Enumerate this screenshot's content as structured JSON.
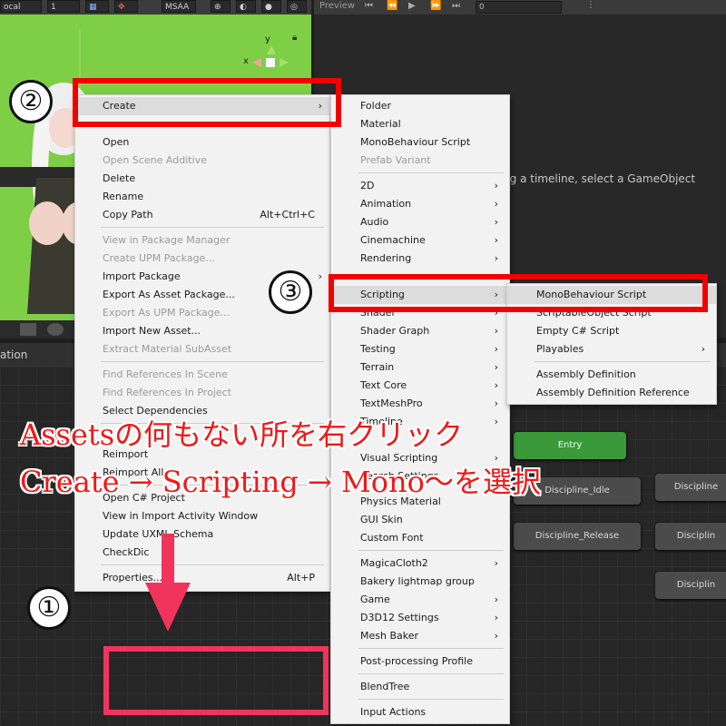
{
  "scene_toolbar": {
    "pivot_label": "ocal",
    "layer_value": "1",
    "msaa_label": "MSAA"
  },
  "preview_toolbar": {
    "label": "Preview",
    "frame_value": "0"
  },
  "timeline": {
    "message": "ting a timeline, select a GameObject"
  },
  "animator": {
    "tab_label": "ation"
  },
  "gizmo": {
    "x_label": "x",
    "y_label": "y"
  },
  "context_menu": {
    "items": [
      {
        "label": "Create",
        "arrow": "›",
        "highlight": true
      },
      {
        "label": "Open"
      },
      {
        "label": "Open Scene Additive",
        "disabled": true
      },
      {
        "label": "Delete"
      },
      {
        "label": "Rename"
      },
      {
        "label": "Copy Path",
        "shortcut": "Alt+Ctrl+C"
      },
      {
        "label": "View in Package Manager",
        "disabled": true
      },
      {
        "label": "Create UPM Package...",
        "disabled": true
      },
      {
        "label": "Import Package",
        "arrow": "›"
      },
      {
        "label": "Export As Asset Package..."
      },
      {
        "label": "Export As UPM Package...",
        "disabled": true
      },
      {
        "label": "Import New Asset..."
      },
      {
        "label": "Extract Material SubAsset",
        "disabled": true
      },
      {
        "label": "Find References In Scene",
        "disabled": true
      },
      {
        "label": "Find References In Project",
        "disabled": true
      },
      {
        "label": "Select Dependencies"
      },
      {
        "label": "Reimport"
      },
      {
        "label": "Reimport All"
      },
      {
        "label": "Open C# Project"
      },
      {
        "label": "View in Import Activity Window"
      },
      {
        "label": "Update UXML Schema"
      },
      {
        "label": "CheckDic"
      },
      {
        "label": "Properties...",
        "shortcut": "Alt+P"
      }
    ]
  },
  "create_submenu": {
    "items": [
      {
        "label": "Folder"
      },
      {
        "label": "Material"
      },
      {
        "label": "MonoBehaviour Script"
      },
      {
        "label": "Prefab Variant",
        "disabled": true
      },
      {
        "label": "2D",
        "arrow": "›"
      },
      {
        "label": "Animation",
        "arrow": "›"
      },
      {
        "label": "Audio",
        "arrow": "›"
      },
      {
        "label": "Cinemachine",
        "arrow": "›"
      },
      {
        "label": "Rendering",
        "arrow": "›"
      },
      {
        "label": "Scripting",
        "arrow": "›",
        "highlight": true
      },
      {
        "label": "Shader",
        "arrow": "›"
      },
      {
        "label": "Shader Graph",
        "arrow": "›"
      },
      {
        "label": "Testing",
        "arrow": "›"
      },
      {
        "label": "Terrain",
        "arrow": "›"
      },
      {
        "label": "Text Core",
        "arrow": "›"
      },
      {
        "label": "TextMeshPro",
        "arrow": "›"
      },
      {
        "label": "Timeline",
        "arrow": "›"
      },
      {
        "label": "Visual Scripting",
        "arrow": "›"
      },
      {
        "label": "Search Settings"
      },
      {
        "label": "Physics Material"
      },
      {
        "label": "GUI Skin"
      },
      {
        "label": "Custom Font"
      },
      {
        "label": "MagicaCloth2",
        "arrow": "›"
      },
      {
        "label": "Bakery lightmap group"
      },
      {
        "label": "Game",
        "arrow": "›"
      },
      {
        "label": "D3D12 Settings",
        "arrow": "›"
      },
      {
        "label": "Mesh Baker",
        "arrow": "›"
      },
      {
        "label": "Post-processing Profile"
      },
      {
        "label": "BlendTree"
      },
      {
        "label": "Input Actions"
      }
    ]
  },
  "scripting_submenu": {
    "items": [
      {
        "label": "MonoBehaviour Script",
        "highlight": true
      },
      {
        "label": "ScriptableObject Script"
      },
      {
        "label": "Empty C# Script"
      },
      {
        "label": "Playables",
        "arrow": "›"
      },
      {
        "label": "Assembly Definition"
      },
      {
        "label": "Assembly Definition Reference"
      }
    ]
  },
  "states": {
    "entry": "Entry",
    "idle": "Discipline_Idle",
    "release": "Discipline_Release",
    "right1": "Discipline",
    "right2": "Disciplin",
    "right3": "Disciplin"
  },
  "annotations": {
    "step1": "①",
    "step2": "②",
    "step3": "③",
    "caption_line1": "Assetsの何もない所を右クリック",
    "caption_line2": "Create → Scripting → Mono〜を選択",
    "colors": {
      "red_box": "#f20000",
      "pink_box": "#f0345c",
      "caption": "#f01818"
    }
  }
}
